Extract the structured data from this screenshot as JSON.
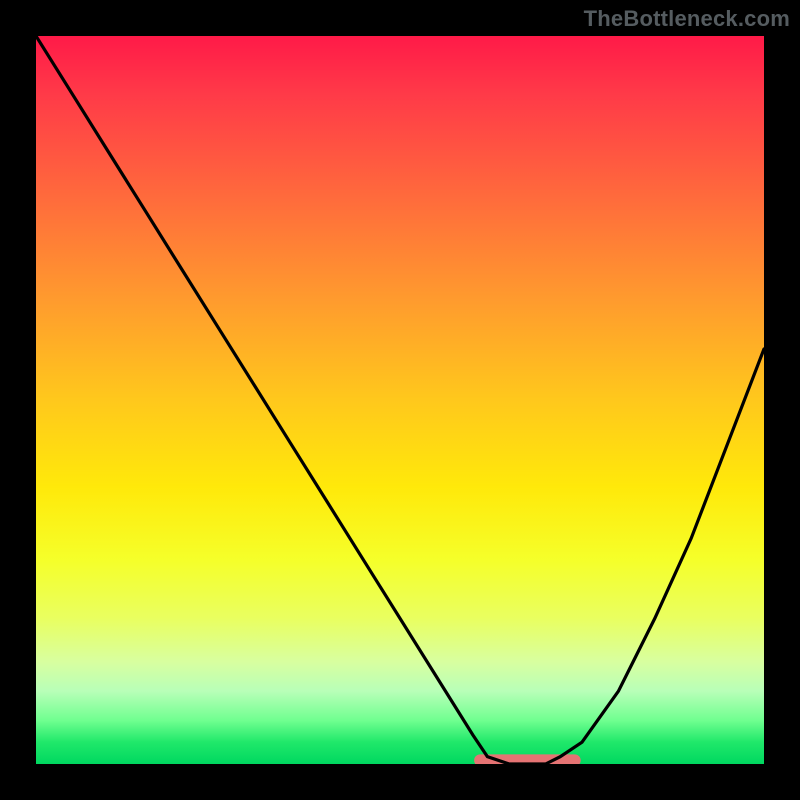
{
  "watermark": "TheBottleneck.com",
  "chart_data": {
    "type": "line",
    "title": "",
    "xlabel": "",
    "ylabel": "",
    "xlim": [
      0,
      100
    ],
    "ylim": [
      0,
      100
    ],
    "grid": false,
    "legend": false,
    "background": "vertical-gradient red→green",
    "series": [
      {
        "name": "bottleneck-curve",
        "x": [
          0,
          5,
          10,
          15,
          20,
          25,
          30,
          35,
          40,
          45,
          50,
          55,
          60,
          62,
          65,
          68,
          70,
          72,
          75,
          80,
          85,
          90,
          95,
          100
        ],
        "y": [
          100,
          92,
          84,
          76,
          68,
          60,
          52,
          44,
          36,
          28,
          20,
          12,
          4,
          1,
          0,
          0,
          0,
          1,
          3,
          10,
          20,
          31,
          44,
          57
        ]
      },
      {
        "name": "sweet-spot-marker",
        "x": [
          61,
          74
        ],
        "y": [
          0.5,
          0.5
        ],
        "style": "thick-pink-segment"
      }
    ],
    "colors": {
      "curve": "#000000",
      "sweet_spot": "#e57373",
      "gradient_top": "#ff1a48",
      "gradient_bottom": "#00d860"
    },
    "annotations": []
  }
}
